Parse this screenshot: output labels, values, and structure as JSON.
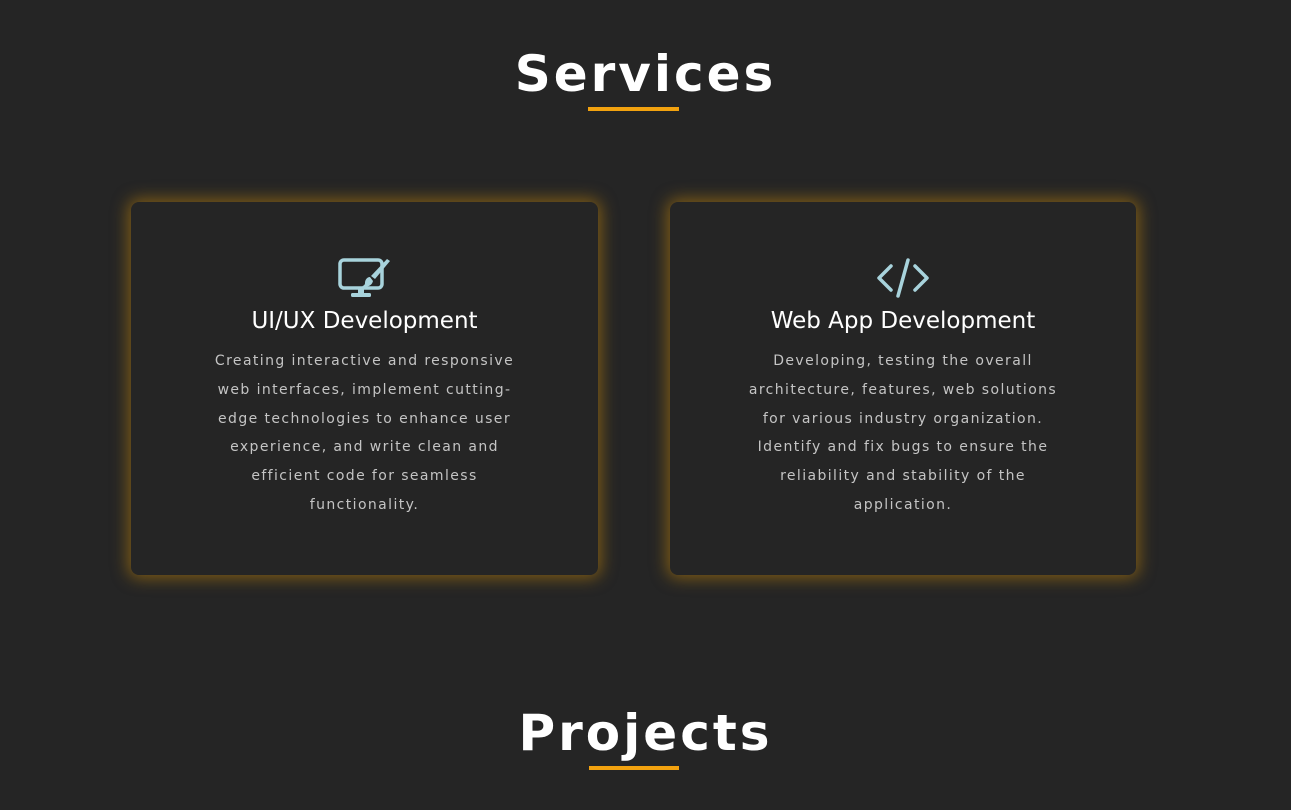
{
  "services": {
    "title": "Services",
    "cards": [
      {
        "icon": "monitor-paintbrush-icon",
        "title": "UI/UX Development",
        "description": "Creating interactive and responsive web interfaces, implement cutting-edge technologies to enhance user experience, and write clean and efficient code for seamless functionality."
      },
      {
        "icon": "code-icon",
        "title": "Web App Development",
        "description": "Developing, testing the overall architecture, features, web solutions for various industry organization. Identify and fix bugs to ensure the reliability and stability of the application."
      }
    ]
  },
  "projects": {
    "title": "Projects"
  },
  "colors": {
    "background": "#252525",
    "accent": "#f2a20f",
    "icon": "#a8d3dc",
    "heading": "#ffffff",
    "body_text": "#c4c4c4"
  }
}
